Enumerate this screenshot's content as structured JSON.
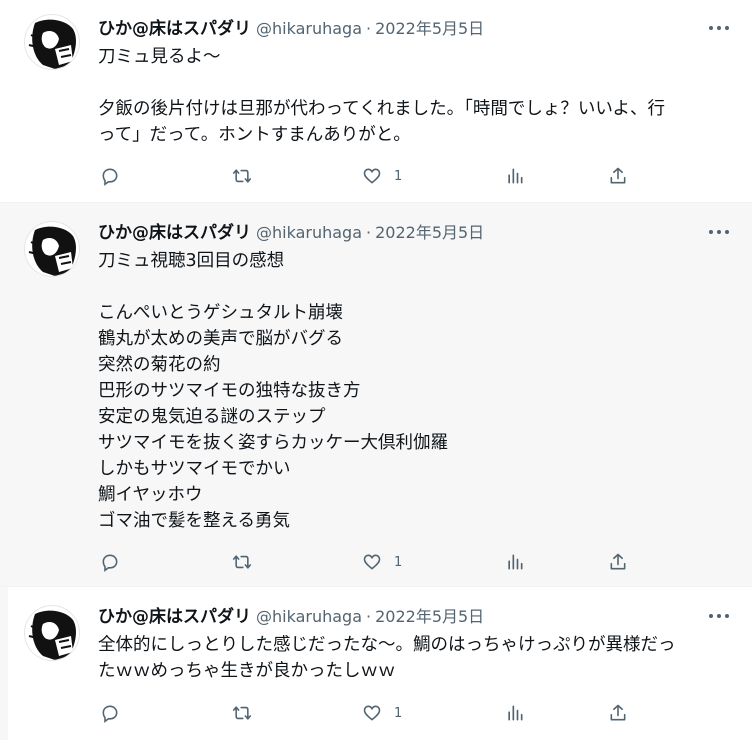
{
  "tweets": [
    {
      "name": "ひか@床はスパダリ",
      "handle": "@hikaruhaga",
      "separator": "·",
      "date": "2022年5月5日",
      "lines": [
        "刀ミュ見るよ〜",
        "",
        "夕飯の後片付けは旦那が代わってくれました。「時間でしょ？いいよ、行",
        "って」だって。ホントすまんありがと。"
      ],
      "like_count": "1"
    },
    {
      "name": "ひか@床はスパダリ",
      "handle": "@hikaruhaga",
      "separator": "·",
      "date": "2022年5月5日",
      "lines": [
        "刀ミュ視聴3回目の感想",
        "",
        "こんぺいとうゲシュタルト崩壊",
        "鶴丸が太めの美声で脳がバグる",
        "突然の菊花の約",
        "巴形のサツマイモの独特な抜き方",
        "安定の鬼気迫る謎のステップ",
        "サツマイモを抜く姿すらカッケー大倶利伽羅",
        "しかもサツマイモでかい",
        "鯛イヤッホウ",
        "ゴマ油で髪を整える勇気"
      ],
      "like_count": "1"
    },
    {
      "name": "ひか@床はスパダリ",
      "handle": "@hikaruhaga",
      "separator": "·",
      "date": "2022年5月5日",
      "lines": [
        "全体的にしっとりした感じだったな〜。鯛のはっちゃけっぷりが異様だっ",
        "たｗｗめっちゃ生きが良かったしｗｗ"
      ],
      "like_count": "1"
    }
  ],
  "icons": {
    "reply": "reply-icon",
    "retweet": "retweet-icon",
    "like": "heart-icon",
    "views": "views-icon",
    "share": "share-icon",
    "more": "more-icon"
  },
  "colors": {
    "text": "#0f1419",
    "secondary": "#536471",
    "selected_background": "#f7f7f7"
  }
}
